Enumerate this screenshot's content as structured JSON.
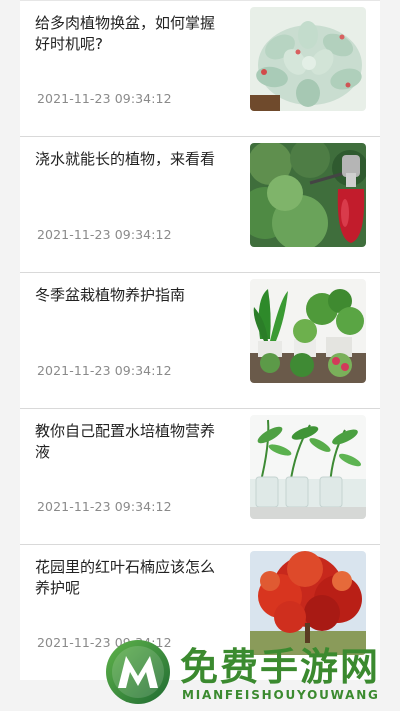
{
  "articles": [
    {
      "title": "给多肉植物换盆，如何掌握好时机呢?",
      "time": "2021-11-23 09:34:12",
      "image": "succulent-image"
    },
    {
      "title": "浇水就能长的植物，来看看",
      "time": "2021-11-23 09:34:12",
      "image": "watering-sprayer-image"
    },
    {
      "title": "冬季盆栽植物养护指南",
      "time": "2021-11-23 09:34:12",
      "image": "potted-plants-image"
    },
    {
      "title": "教你自己配置水培植物营养液",
      "time": "2021-11-23 09:34:12",
      "image": "hydroponic-plants-image"
    },
    {
      "title": "花园里的红叶石楠应该怎么养护呢",
      "time": "2021-11-23 09:34:12",
      "image": "red-leaf-tree-image"
    }
  ],
  "watermark": {
    "cn": "免费手游网",
    "en": "MIANFEISHOUYOUWANG",
    "color": "#3b8a2f"
  }
}
